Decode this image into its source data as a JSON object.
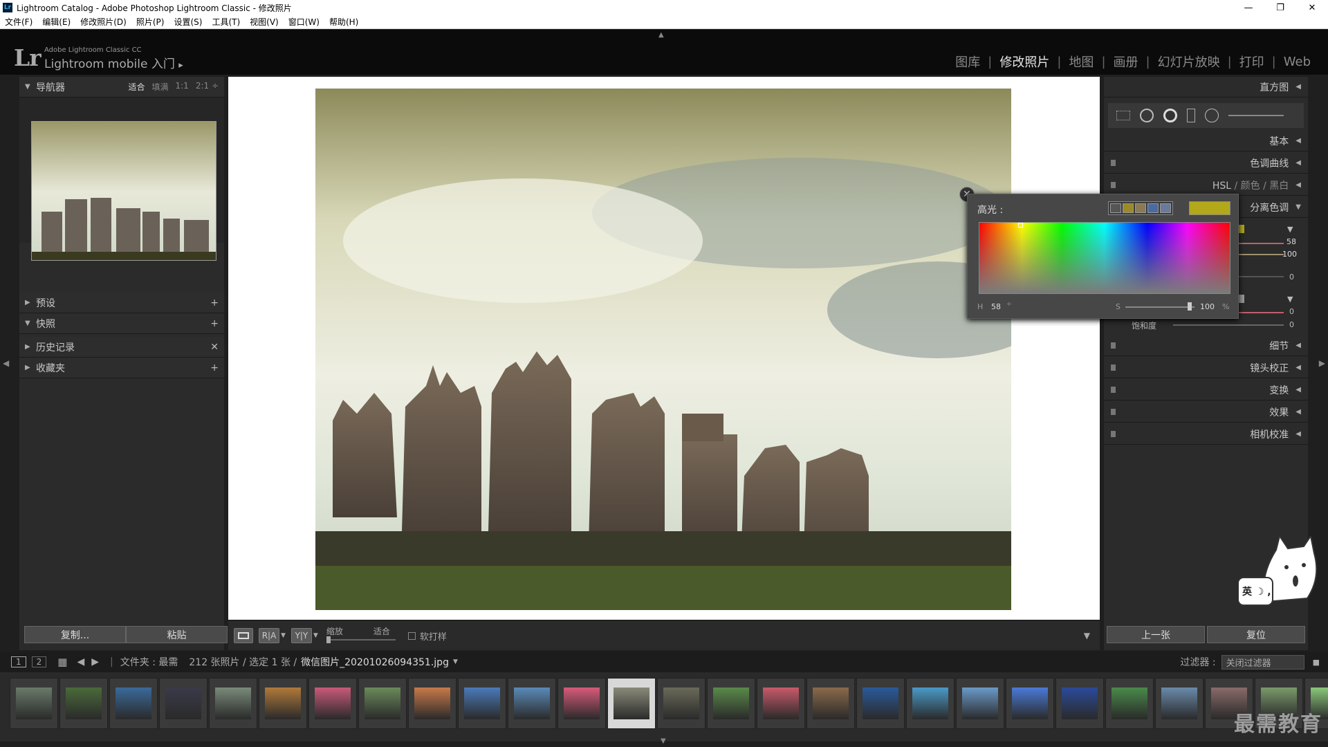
{
  "window": {
    "title": "Lightroom Catalog - Adobe Photoshop Lightroom Classic - 修改照片",
    "controls": [
      "—",
      "❐",
      "✕"
    ]
  },
  "menu": [
    "文件(F)",
    "编辑(E)",
    "修改照片(D)",
    "照片(P)",
    "设置(S)",
    "工具(T)",
    "视图(V)",
    "窗口(W)",
    "帮助(H)"
  ],
  "identity": {
    "logo": "Lr",
    "product": "Adobe Lightroom Classic CC",
    "mobile": "Lightroom mobile 入门",
    "play": "▸"
  },
  "modules": [
    "图库",
    "修改照片",
    "地图",
    "画册",
    "幻灯片放映",
    "打印",
    "Web"
  ],
  "active_module": "修改照片",
  "left_panel": {
    "navigator": {
      "title": "导航器",
      "modes": [
        "适合",
        "填满",
        "1:1",
        "2:1 ÷"
      ],
      "selected_mode": "适合"
    },
    "sections": [
      {
        "title": "预设",
        "action": "+",
        "open": false
      },
      {
        "title": "快照",
        "action": "+",
        "open": true
      },
      {
        "title": "历史记录",
        "action": "✕",
        "open": false
      },
      {
        "title": "收藏夹",
        "action": "+",
        "open": false
      }
    ],
    "copy_button": "复制...",
    "paste_button": "粘贴"
  },
  "toolbar": {
    "zoom_label": "缩放",
    "fit_label": "适合",
    "softproof_label": "软打样",
    "softproof_checked": false,
    "compare_ra": "R|A",
    "compare_yy": "Y|Y"
  },
  "right_panel": {
    "histogram_title": "直方图",
    "sections": [
      {
        "title": "基本"
      },
      {
        "title": "色调曲线"
      },
      {
        "title": "HSL / 颜色 / 黑白"
      },
      {
        "title": "分离色调"
      },
      {
        "title": "细节"
      },
      {
        "title": "镜头校正"
      },
      {
        "title": "变换"
      },
      {
        "title": "效果"
      },
      {
        "title": "相机校准"
      }
    ],
    "split_values": {
      "hue": "58",
      "saturation": "100",
      "balance": "0",
      "shadow_hue": "0",
      "shadow_sat": "0",
      "sat_label": "饱和度"
    },
    "hsl_parts": [
      "HSL",
      "/",
      "颜色",
      "/",
      "黑白"
    ],
    "prev_button": "上一张",
    "reset_button": "复位"
  },
  "color_popup": {
    "label": "高光 :",
    "h_label": "H",
    "h_value": "58",
    "s_label": "S",
    "s_value": "100",
    "percent": "%",
    "selected_color": "#b3a81a",
    "swatches": [
      "#555555",
      "#9a8a28",
      "#8a7a55",
      "#4a6aa0",
      "#6a7a9a"
    ],
    "hue": 58,
    "saturation": 100
  },
  "filmstrip": {
    "page1": "1",
    "page2": "2",
    "source": "文件夹 : 最需",
    "count": "212 张照片 / 选定 1 张 /",
    "filename": "微信图片_20201026094351.jpg",
    "filter_label": "过滤器 :",
    "filter_value": "关闭过滤器",
    "thumb_colors": [
      "#6a7a6a",
      "#4a6a3a",
      "#3a6a9a",
      "#3a3a4a",
      "#7a8a7a",
      "#b07a3a",
      "#c85a7a",
      "#6a8a5a",
      "#c87a4a",
      "#4a7ab8",
      "#5a8ab8",
      "#d85a7a",
      "#8a8a7a",
      "#6a6a5a",
      "#5a8a4a",
      "#c85a6a",
      "#8a6a4a",
      "#2a5a9a",
      "#4a9ac8",
      "#6a9ac8",
      "#4a7ad8",
      "#2a4a9a",
      "#4a8a4a",
      "#6a8aaa",
      "#8a6a6a",
      "#7a9a6a",
      "#8ac87a"
    ]
  },
  "mascot_text": "英 ☽ ,",
  "watermark": "最需教育"
}
